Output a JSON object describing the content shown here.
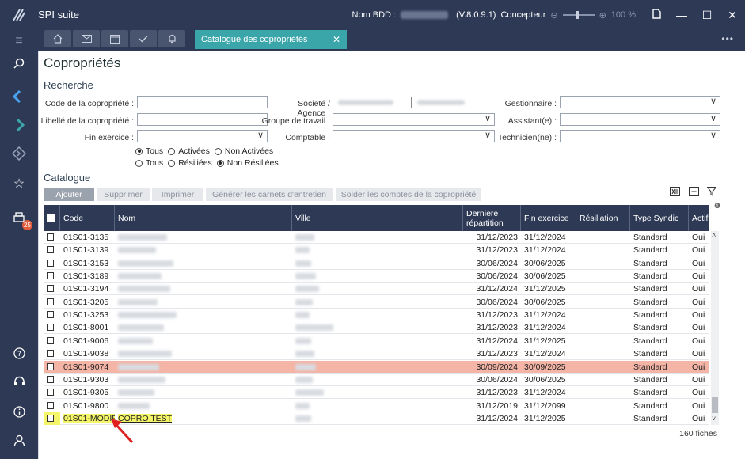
{
  "window": {
    "title": "SPI suite",
    "db_label": "Nom BDD :",
    "version": "(V.8.0.9.1)",
    "role": "Concepteur",
    "zoom": "100 %"
  },
  "tabs": {
    "active_label": "Catalogue des copropriétés"
  },
  "rail": {
    "badge_count": "25"
  },
  "page": {
    "title": "Copropriétés"
  },
  "search": {
    "title": "Recherche",
    "labels": {
      "code": "Code de la copropriété :",
      "libelle": "Libellé de la copropriété :",
      "fin_exercice": "Fin exercice :",
      "societe": "Société / Agence :",
      "groupe": "Groupe de travail :",
      "comptable": "Comptable :",
      "gestionnaire": "Gestionnaire :",
      "assistant": "Assistant(e) :",
      "technicien": "Technicien(ne) :"
    },
    "radio1": {
      "all": "Tous",
      "active": "Activées",
      "inactive": "Non Activées"
    },
    "radio2": {
      "all": "Tous",
      "resiliated": "Résiliées",
      "not_resiliated": "Non Résiliées"
    }
  },
  "catalogue": {
    "title": "Catalogue",
    "buttons": {
      "add": "Ajouter",
      "delete": "Supprimer",
      "print": "Imprimer",
      "generate": "Générer les carnets d'entretien",
      "settle": "Solder les comptes de la copropriété"
    },
    "columns": {
      "code": "Code",
      "name": "Nom",
      "city": "Ville",
      "last_rep_1": "Dernière",
      "last_rep_2": "répartition",
      "fin_ex": "Fin exercice",
      "resil": "Résiliation",
      "type": "Type Syndic",
      "actif": "Actif"
    },
    "rows": [
      {
        "code": "01S01-3135",
        "last_rep": "31/12/2023",
        "fin_ex": "31/12/2024",
        "type": "Standard",
        "actif": "Oui"
      },
      {
        "code": "01S01-3139",
        "last_rep": "31/12/2023",
        "fin_ex": "31/12/2024",
        "type": "Standard",
        "actif": "Oui"
      },
      {
        "code": "01S01-3153",
        "last_rep": "30/06/2024",
        "fin_ex": "30/06/2025",
        "type": "Standard",
        "actif": "Oui"
      },
      {
        "code": "01S01-3189",
        "last_rep": "30/06/2024",
        "fin_ex": "30/06/2025",
        "type": "Standard",
        "actif": "Oui"
      },
      {
        "code": "01S01-3194",
        "last_rep": "31/12/2024",
        "fin_ex": "31/12/2025",
        "type": "Standard",
        "actif": "Oui"
      },
      {
        "code": "01S01-3205",
        "last_rep": "30/06/2024",
        "fin_ex": "30/06/2025",
        "type": "Standard",
        "actif": "Oui"
      },
      {
        "code": "01S01-3253",
        "last_rep": "31/12/2023",
        "fin_ex": "31/12/2024",
        "type": "Standard",
        "actif": "Oui"
      },
      {
        "code": "01S01-8001",
        "last_rep": "31/12/2023",
        "fin_ex": "31/12/2024",
        "type": "Standard",
        "actif": "Oui"
      },
      {
        "code": "01S01-9006",
        "last_rep": "31/12/2024",
        "fin_ex": "31/12/2025",
        "type": "Standard",
        "actif": "Oui"
      },
      {
        "code": "01S01-9038",
        "last_rep": "31/12/2023",
        "fin_ex": "31/12/2024",
        "type": "Standard",
        "actif": "Oui"
      },
      {
        "code": "01S01-9074",
        "last_rep": "30/09/2024",
        "fin_ex": "30/09/2025",
        "type": "Standard",
        "actif": "Oui"
      },
      {
        "code": "01S01-9303",
        "last_rep": "30/06/2024",
        "fin_ex": "30/06/2025",
        "type": "Standard",
        "actif": "Oui"
      },
      {
        "code": "01S01-9305",
        "last_rep": "31/12/2023",
        "fin_ex": "31/12/2024",
        "type": "Standard",
        "actif": "Oui"
      },
      {
        "code": "01S01-9800",
        "last_rep": "31/12/2019",
        "fin_ex": "31/12/2099",
        "type": "Standard",
        "actif": "Oui"
      },
      {
        "code": "01S01-MODIF",
        "name": "COPRO TEST",
        "last_rep": "31/12/2024",
        "fin_ex": "31/12/2025",
        "type": "Standard",
        "actif": "Oui"
      }
    ],
    "count": "160 fiches"
  },
  "colors": {
    "chrome": "#2e3a55",
    "accent_tab": "#3aa6a9",
    "selected_row": "#f4b4a6",
    "highlight": "#f5f56a"
  }
}
